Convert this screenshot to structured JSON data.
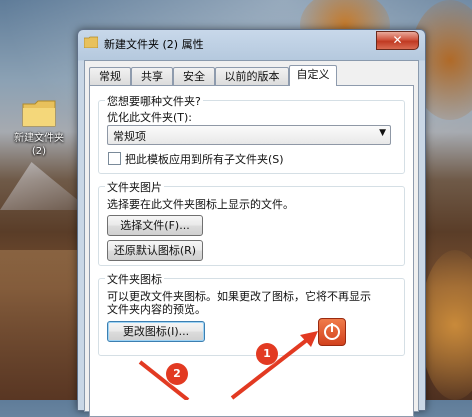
{
  "desktop": {
    "folder_label_line1": "新建文件夹",
    "folder_label_line2": "(2)"
  },
  "window": {
    "title": "新建文件夹 (2) 属性",
    "close_symbol": "✕"
  },
  "tabs": [
    {
      "label": "常规"
    },
    {
      "label": "共享"
    },
    {
      "label": "安全"
    },
    {
      "label": "以前的版本"
    },
    {
      "label": "自定义",
      "active": true
    }
  ],
  "folder_type": {
    "group_title": "您想要哪种文件夹?",
    "optimize_label": "优化此文件夹(T):",
    "selected_option": "常规项",
    "apply_template_label": "把此模板应用到所有子文件夹(S)",
    "apply_template_checked": false
  },
  "folder_pictures": {
    "group_title": "文件夹图片",
    "description": "选择要在此文件夹图标上显示的文件。",
    "choose_file_button": "选择文件(F)...",
    "restore_default_button": "还原默认图标(R)"
  },
  "folder_icons": {
    "group_title": "文件夹图标",
    "description_line1": "可以更改文件夹图标。如果更改了图标，它将不再显示",
    "description_line2": "文件夹内容的预览。",
    "change_icon_button": "更改图标(I)..."
  },
  "annotations": {
    "marker1": "1",
    "marker2": "2",
    "accent": "#e23a22"
  }
}
